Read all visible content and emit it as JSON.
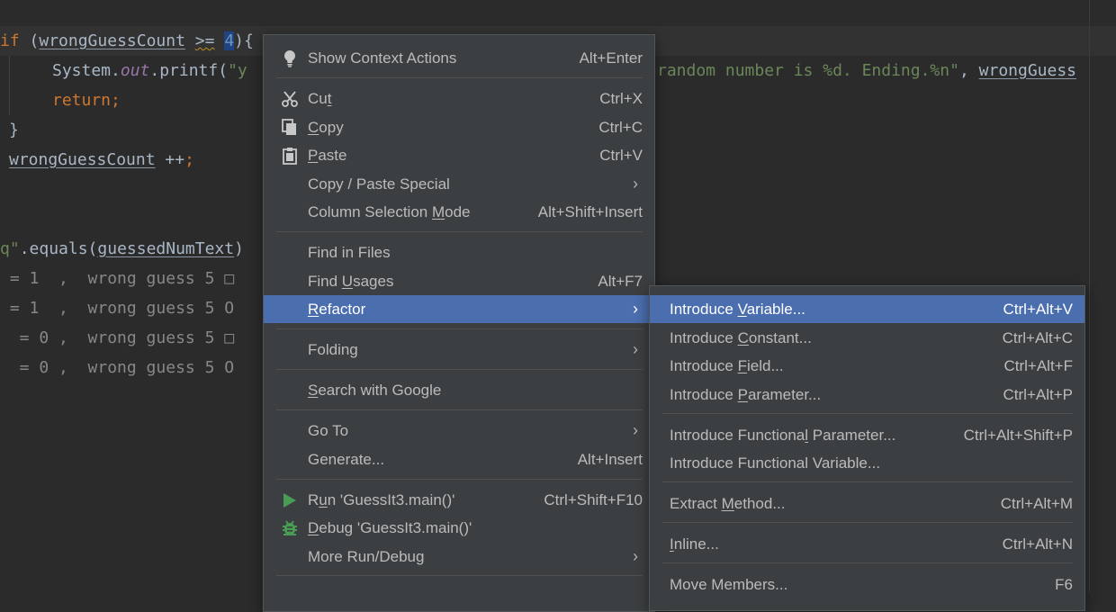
{
  "editor": {
    "lines": {
      "if_kw": "if",
      "if_open": " (",
      "wrong_var": "wrongGuessCount",
      "op_space": " ",
      "op": ">=",
      "op_space2": " ",
      "num": "4",
      "num_close": "){",
      "sys": "System.",
      "out_field": "out",
      "printf": ".printf(",
      "str_start": "\"y",
      "str_rest": "random number is %d. Ending.%n\"",
      "comma": ", ",
      "trailing_var": "wrongGuess",
      "return_kw": "return",
      "semicolon": ";",
      "close_brace": "}",
      "incr_var": "wrongGuessCount",
      "incr_op": " ++",
      "incr_semi": ";",
      "equals_str": "q\"",
      "equals_call": ".equals(",
      "guessed_var": "guessedNumText",
      "equals_close": ")"
    },
    "output_lines": [
      " = 1  ,  wrong guess 5 □",
      " = 1  ,  wrong guess 5 O",
      "  = 0 ,  wrong guess 5 □",
      "  = 0 ,  wrong guess 5 O"
    ]
  },
  "context_menu": {
    "items": [
      {
        "icon": "lightbulb-icon",
        "pre": "Show Context Actions",
        "u": "",
        "post": "",
        "shortcut": "Alt+Enter"
      },
      {
        "icon": "scissors-icon",
        "pre": "Cu",
        "u": "t",
        "post": "",
        "shortcut": "Ctrl+X"
      },
      {
        "icon": "copy-icon",
        "pre": "",
        "u": "C",
        "post": "opy",
        "shortcut": "Ctrl+C"
      },
      {
        "icon": "paste-icon",
        "pre": "",
        "u": "P",
        "post": "aste",
        "shortcut": "Ctrl+V"
      },
      {
        "icon": "",
        "pre": "Copy / Paste Special",
        "u": "",
        "post": "",
        "shortcut": ""
      },
      {
        "icon": "",
        "pre": "Column Selection ",
        "u": "M",
        "post": "ode",
        "shortcut": "Alt+Shift+Insert"
      },
      {
        "icon": "",
        "pre": "Find in Files",
        "u": "",
        "post": "",
        "shortcut": ""
      },
      {
        "icon": "",
        "pre": "Find ",
        "u": "U",
        "post": "sages",
        "shortcut": "Alt+F7"
      },
      {
        "icon": "",
        "pre": "",
        "u": "R",
        "post": "efactor",
        "shortcut": ""
      },
      {
        "icon": "",
        "pre": "Folding",
        "u": "",
        "post": "",
        "shortcut": ""
      },
      {
        "icon": "",
        "pre": "",
        "u": "S",
        "post": "earch with Google",
        "shortcut": ""
      },
      {
        "icon": "",
        "pre": "Go To",
        "u": "",
        "post": "",
        "shortcut": ""
      },
      {
        "icon": "",
        "pre": "Generate...",
        "u": "",
        "post": "",
        "shortcut": "Alt+Insert"
      },
      {
        "icon": "run-icon",
        "pre": "R",
        "u": "u",
        "post": "n 'GuessIt3.main()'",
        "shortcut": "Ctrl+Shift+F10"
      },
      {
        "icon": "debug-icon",
        "pre": "",
        "u": "D",
        "post": "ebug 'GuessIt3.main()'",
        "shortcut": ""
      },
      {
        "icon": "",
        "pre": "More Run/Debug",
        "u": "",
        "post": "",
        "shortcut": ""
      }
    ]
  },
  "refactor_submenu": {
    "items": [
      {
        "pre": "Introduce ",
        "u": "V",
        "post": "ariable...",
        "shortcut": "Ctrl+Alt+V"
      },
      {
        "pre": "Introduce ",
        "u": "C",
        "post": "onstant...",
        "shortcut": "Ctrl+Alt+C"
      },
      {
        "pre": "Introduce ",
        "u": "F",
        "post": "ield...",
        "shortcut": "Ctrl+Alt+F"
      },
      {
        "pre": "Introduce ",
        "u": "P",
        "post": "arameter...",
        "shortcut": "Ctrl+Alt+P"
      },
      {
        "pre": "Introduce Functiona",
        "u": "l",
        "post": " Parameter...",
        "shortcut": "Ctrl+Alt+Shift+P"
      },
      {
        "pre": "Introduce Functional Variable...",
        "u": "",
        "post": "",
        "shortcut": ""
      },
      {
        "pre": "Extract ",
        "u": "M",
        "post": "ethod...",
        "shortcut": "Ctrl+Alt+M"
      },
      {
        "pre": "",
        "u": "I",
        "post": "nline...",
        "shortcut": "Ctrl+Alt+N"
      },
      {
        "pre": "Move Members...",
        "u": "",
        "post": "",
        "shortcut": "F6"
      }
    ]
  },
  "colors": {
    "menu_bg": "#3c3f41",
    "selection": "#4b6eaf",
    "editor_bg": "#2b2b2b",
    "run_green": "#499c54"
  }
}
